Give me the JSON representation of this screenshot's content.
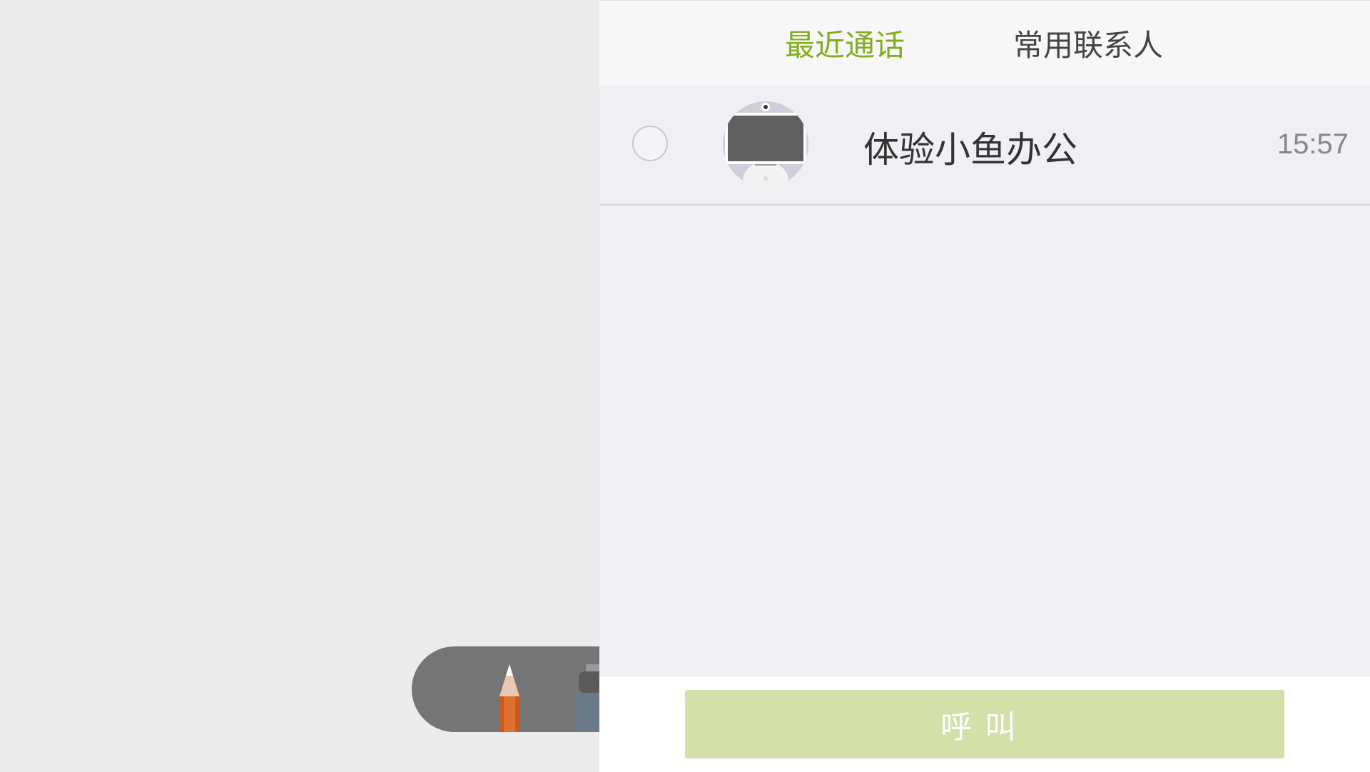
{
  "tabs": {
    "recent_calls": "最近通话",
    "frequent_contacts": "常用联系人",
    "active": "recent_calls"
  },
  "call_list": [
    {
      "name": "体验小鱼办公",
      "time": "15:57",
      "avatar_icon": "robot-device-icon",
      "selected": false
    }
  ],
  "call_button": {
    "label": "呼叫"
  },
  "toolbar": {
    "tools": [
      "pencil-icon",
      "marker-icon"
    ]
  },
  "colors": {
    "accent": "#7fae1e",
    "call_button_bg": "#d4e0aa",
    "panel_bg": "#f0f0f4",
    "canvas_bg": "#ebebeb",
    "toolbar_bg": "#757575"
  }
}
